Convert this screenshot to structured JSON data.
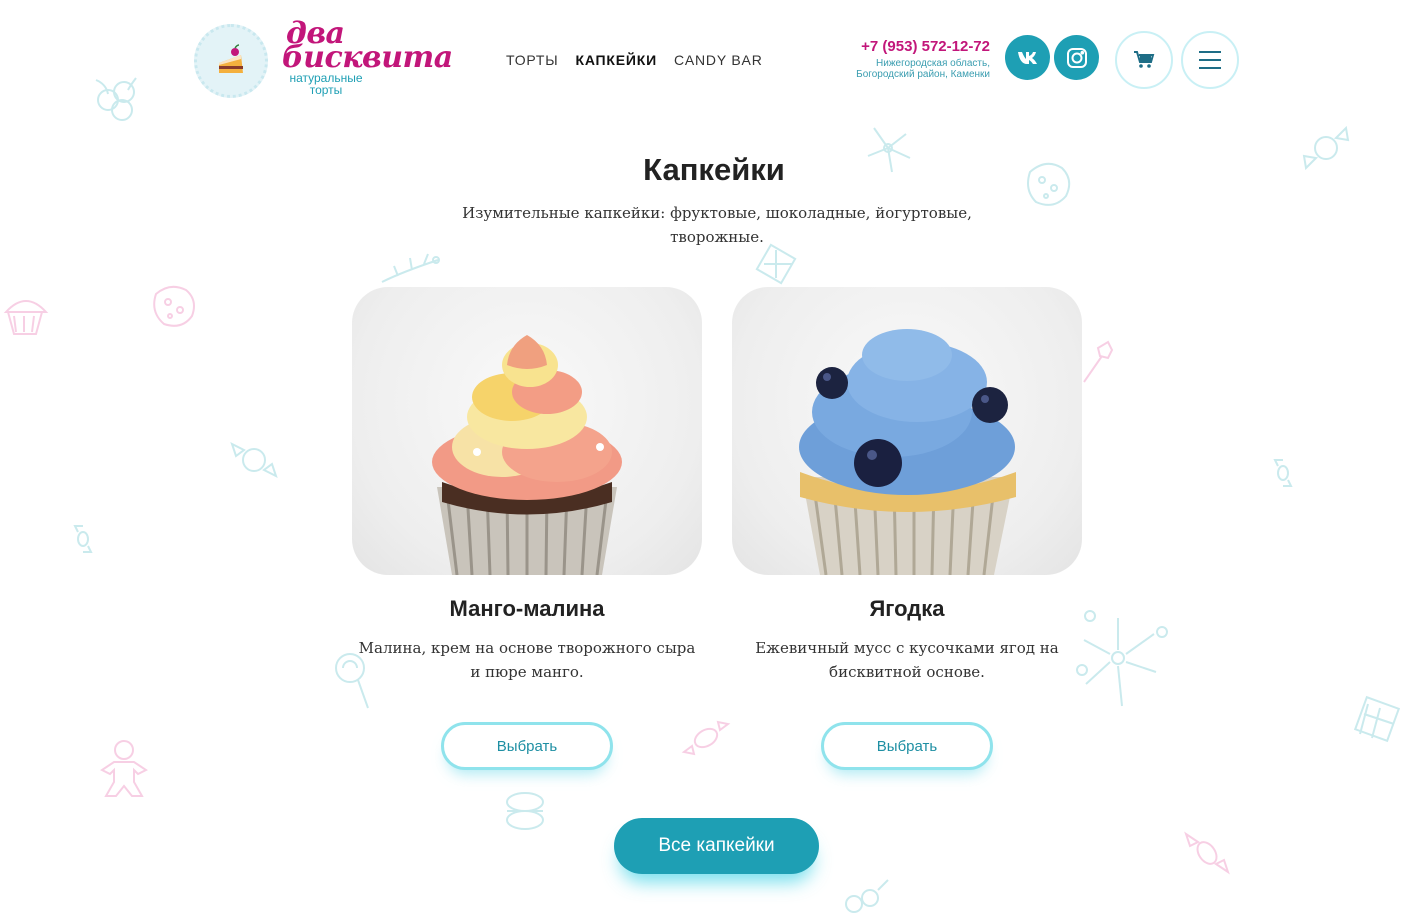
{
  "header": {
    "logo_line1": "два",
    "logo_line2": "бисквита",
    "logo_tagline": "натуральные торты",
    "nav": [
      {
        "label": "ТОРТЫ",
        "active": false
      },
      {
        "label": "КАПКЕЙКИ",
        "active": true
      },
      {
        "label": "CANDY BAR",
        "active": false
      }
    ],
    "phone": "+7 (953) 572-12-72",
    "address_line1": "Нижегородская область,",
    "address_line2": "Богородский район, Каменки",
    "icons": {
      "vk": "vk-icon",
      "instagram": "instagram-icon",
      "cart": "cart-icon",
      "menu": "menu-icon"
    }
  },
  "section": {
    "title": "Капкейки",
    "subtitle": "Изумительные капкейки: фруктовые, шоколадные, йогуртовые, творожные."
  },
  "products": [
    {
      "name": "Манго-малина",
      "description": "Малина, крем на основе творожного сыра и пюре манго.",
      "button": "Выбрать"
    },
    {
      "name": "Ягодка",
      "description": "Ежевичный мусс с кусочками ягод на бисквитной основе.",
      "button": "Выбрать"
    }
  ],
  "all_button": "Все капкейки",
  "colors": {
    "brand_magenta": "#c2167a",
    "accent_teal": "#1e9fb4",
    "button_border": "#8fe3ec"
  }
}
